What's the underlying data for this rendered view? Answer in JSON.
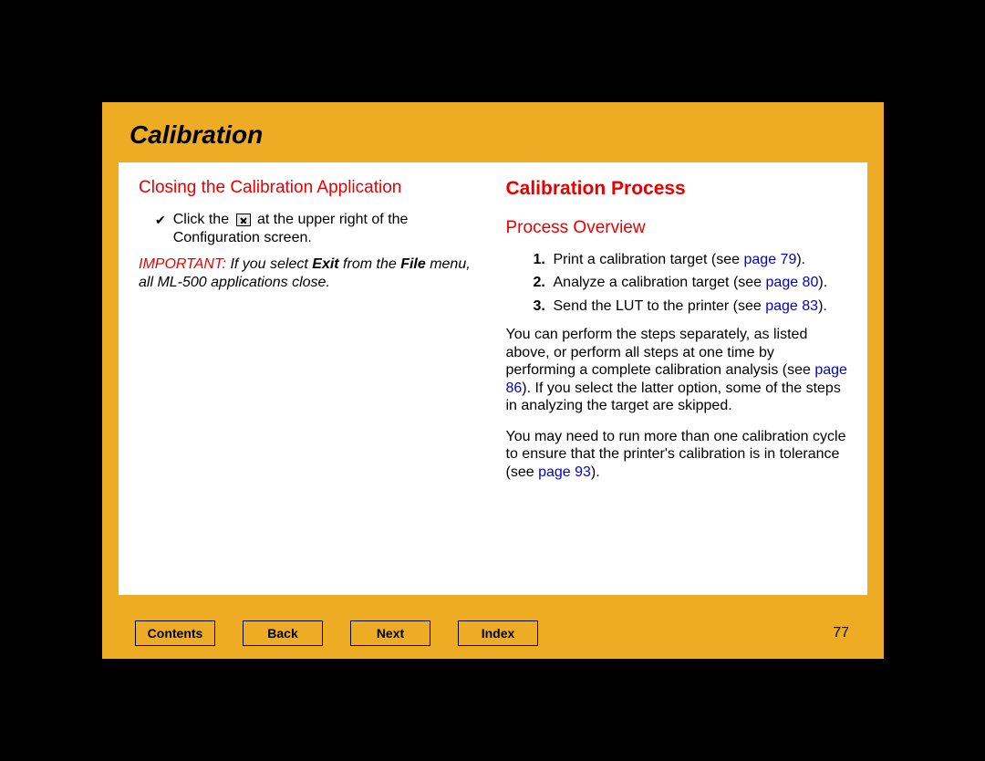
{
  "header": {
    "title": "Calibration"
  },
  "left": {
    "heading": "Closing the Calibration Application",
    "bullet_pre": "Click the ",
    "bullet_post": " at the upper right of the Configuration screen.",
    "important_label": "IMPORTANT:",
    "important_text_1": " If you select ",
    "important_exit": "Exit",
    "important_text_2": " from the ",
    "important_file": "File",
    "important_text_3": " menu, all ML-500 applications close."
  },
  "right": {
    "heading": "Calibration Process",
    "subheading": "Process Overview",
    "steps": [
      {
        "num": "1.",
        "text": "Print a calibration target (see ",
        "link": "page 79",
        "after": ")."
      },
      {
        "num": "2.",
        "text": "Analyze a calibration target (see ",
        "link": "page 80",
        "after": ")."
      },
      {
        "num": "3.",
        "text": "Send the LUT to the printer (see ",
        "link": "page 83",
        "after": ")."
      }
    ],
    "para1_a": "You can perform the steps separately, as listed above, or perform all steps at one time by performing a complete calibration analysis (see ",
    "para1_link": "page 86",
    "para1_b": "). If you select the latter option, some of the steps in analyzing the target are skipped.",
    "para2_a": "You may need to run more than one calibration cycle to ensure that the printer's calibration is in tolerance (see ",
    "para2_link": "page 93",
    "para2_b": ")."
  },
  "footer": {
    "buttons": {
      "contents": "Contents",
      "back": "Back",
      "next": "Next",
      "index": "Index"
    },
    "page": "77"
  }
}
